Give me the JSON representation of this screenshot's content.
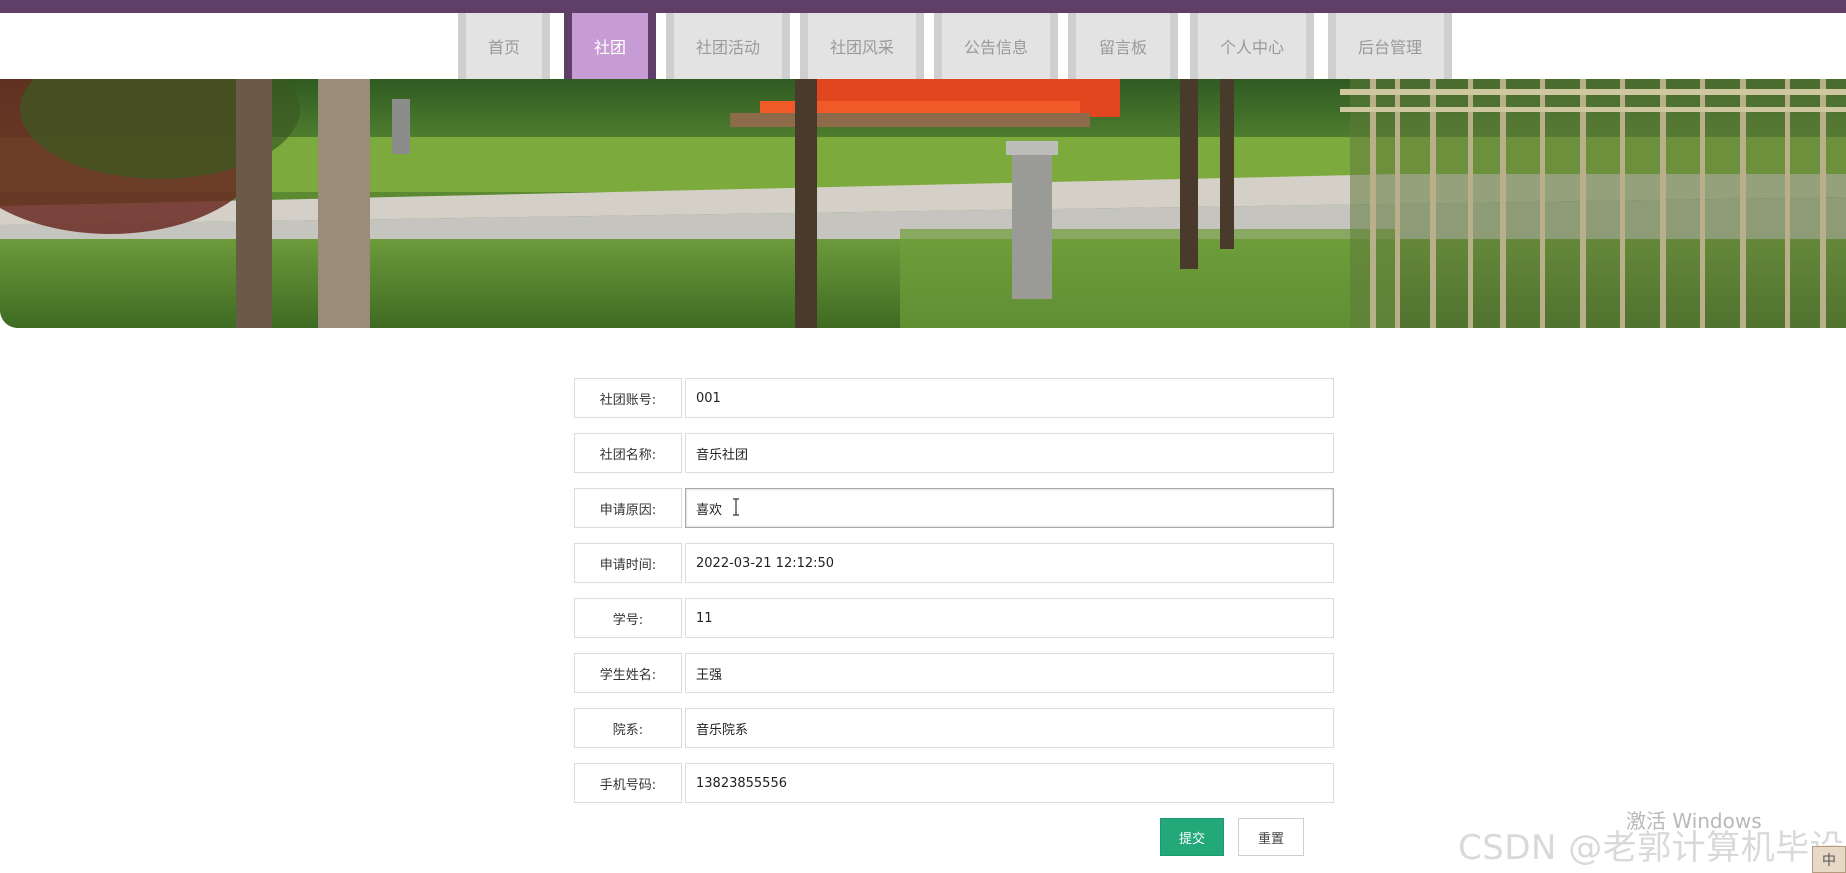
{
  "nav": {
    "items": [
      {
        "label": "首页"
      },
      {
        "label": "社团",
        "active": true
      },
      {
        "label": "社团活动"
      },
      {
        "label": "社团风采"
      },
      {
        "label": "公告信息"
      },
      {
        "label": "留言板"
      },
      {
        "label": "个人中心"
      },
      {
        "label": "后台管理"
      }
    ]
  },
  "form": {
    "fields": [
      {
        "label": "社团账号:",
        "value": "001"
      },
      {
        "label": "社团名称:",
        "value": "音乐社团"
      },
      {
        "label": "申请原因:",
        "value": "喜欢"
      },
      {
        "label": "申请时间:",
        "value": "2022-03-21 12:12:50"
      },
      {
        "label": "学号:",
        "value": "11"
      },
      {
        "label": "学生姓名:",
        "value": "王强"
      },
      {
        "label": "院系:",
        "value": "音乐院系"
      },
      {
        "label": "手机号码:",
        "value": "13823855556"
      }
    ],
    "submit_label": "提交",
    "reset_label": "重置"
  },
  "overlay": {
    "activate_windows": "激活 Windows",
    "csdn_watermark": "CSDN @老郭计算机毕设",
    "ime_label": "中"
  },
  "colors": {
    "top_strip": "#5f3e68",
    "nav_active": "#c79bd3",
    "submit": "#23a87a"
  }
}
